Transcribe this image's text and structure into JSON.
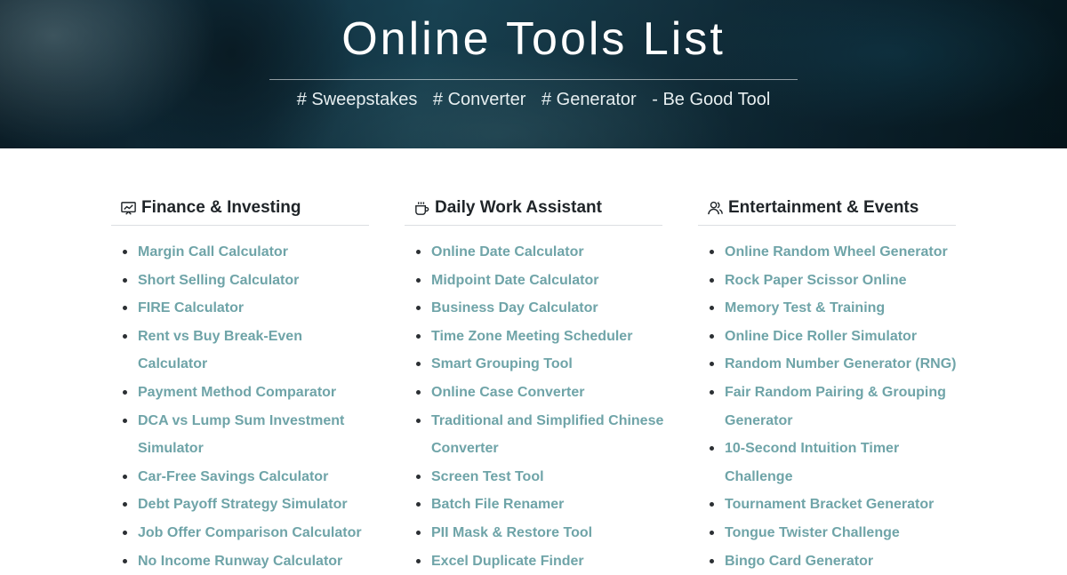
{
  "hero": {
    "title": "Online Tools List",
    "tags": [
      "# Sweepstakes",
      "# Converter",
      "# Generator",
      "- Be Good Tool"
    ]
  },
  "columns": [
    {
      "title": "Finance & Investing",
      "icon": "presentation-chart-icon",
      "items": [
        "Margin Call Calculator",
        "Short Selling Calculator",
        "FIRE Calculator",
        "Rent vs Buy Break-Even Calculator",
        "Payment Method Comparator",
        "DCA vs Lump Sum Investment Simulator",
        "Car-Free Savings Calculator",
        "Debt Payoff Strategy Simulator",
        "Job Offer Comparison Calculator",
        "No Income Runway Calculator"
      ]
    },
    {
      "title": "Daily Work Assistant",
      "icon": "coffee-cup-icon",
      "items": [
        "Online Date Calculator",
        "Midpoint Date Calculator",
        "Business Day Calculator",
        "Time Zone Meeting Scheduler",
        "Smart Grouping Tool",
        "Online Case Converter",
        "Traditional and Simplified Chinese Converter",
        "Screen Test Tool",
        "Batch File Renamer",
        "PII Mask & Restore Tool",
        "Excel Duplicate Finder"
      ]
    },
    {
      "title": "Entertainment & Events",
      "icon": "people-icon",
      "items": [
        "Online Random Wheel Generator",
        "Rock Paper Scissor Online",
        "Memory Test & Training",
        "Online Dice Roller Simulator",
        "Random Number Generator (RNG)",
        "Fair Random Pairing & Grouping Generator",
        "10-Second Intuition Timer Challenge",
        "Tournament Bracket Generator",
        "Tongue Twister Challenge",
        "Bingo Card Generator"
      ]
    }
  ]
}
